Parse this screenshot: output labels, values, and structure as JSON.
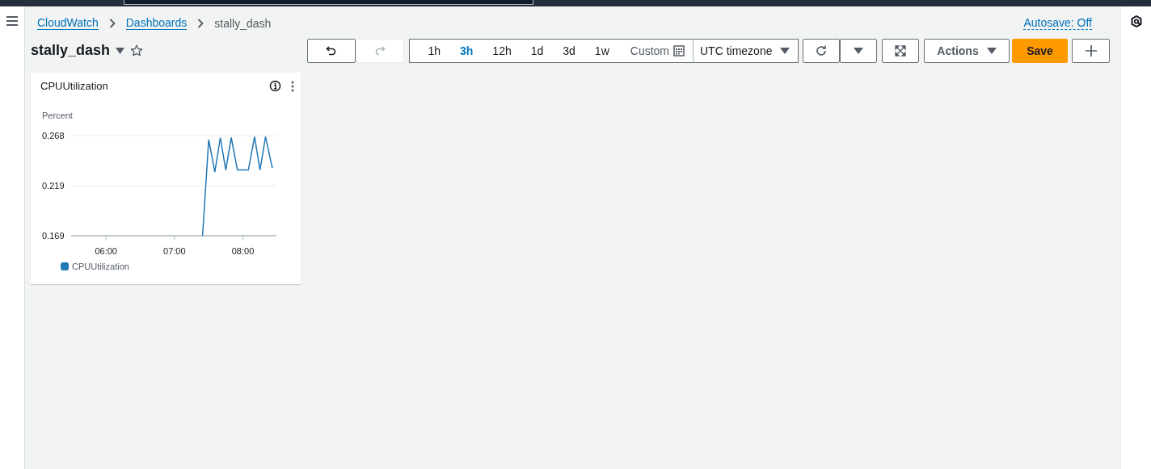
{
  "breadcrumbs": [
    {
      "label": "CloudWatch",
      "link": true
    },
    {
      "label": "Dashboards",
      "link": true
    },
    {
      "label": "stally_dash",
      "link": false
    }
  ],
  "autosave": "Autosave: Off",
  "dashboard": {
    "title": "stally_dash",
    "favorite": false
  },
  "toolbar": {
    "undo_disabled": false,
    "redo_disabled": true,
    "time_ranges": [
      {
        "label": "1h",
        "selected": false
      },
      {
        "label": "3h",
        "selected": true
      },
      {
        "label": "12h",
        "selected": false
      },
      {
        "label": "1d",
        "selected": false
      },
      {
        "label": "3d",
        "selected": false
      },
      {
        "label": "1w",
        "selected": false
      }
    ],
    "custom": "Custom",
    "timezone": "UTC timezone",
    "actions": "Actions",
    "save": "Save"
  },
  "widgets": [
    {
      "title": "CPUUtilization",
      "chart_data": {
        "type": "line",
        "ylabel": "Percent",
        "x": [
          7.41,
          7.5,
          7.59,
          7.67,
          7.75,
          7.83,
          7.92,
          8.08,
          8.17,
          8.25,
          8.33,
          8.43
        ],
        "series": [
          {
            "name": "CPUUtilization",
            "color": "#1f77b4",
            "values": [
              0.169,
              0.264,
              0.232,
              0.266,
              0.234,
              0.266,
              0.234,
              0.234,
              0.267,
              0.234,
              0.267,
              0.236
            ]
          }
        ],
        "xlim": [
          5.49,
          8.49
        ],
        "ylim": [
          0.169,
          0.268
        ],
        "xticks": [
          {
            "value": 6,
            "label": "06:00"
          },
          {
            "value": 7,
            "label": "07:00"
          },
          {
            "value": 8,
            "label": "08:00"
          }
        ],
        "yticks": [
          {
            "value": 0.169,
            "label": "0.169"
          },
          {
            "value": 0.2185,
            "label": "0.219"
          },
          {
            "value": 0.268,
            "label": "0.268"
          }
        ]
      }
    }
  ]
}
